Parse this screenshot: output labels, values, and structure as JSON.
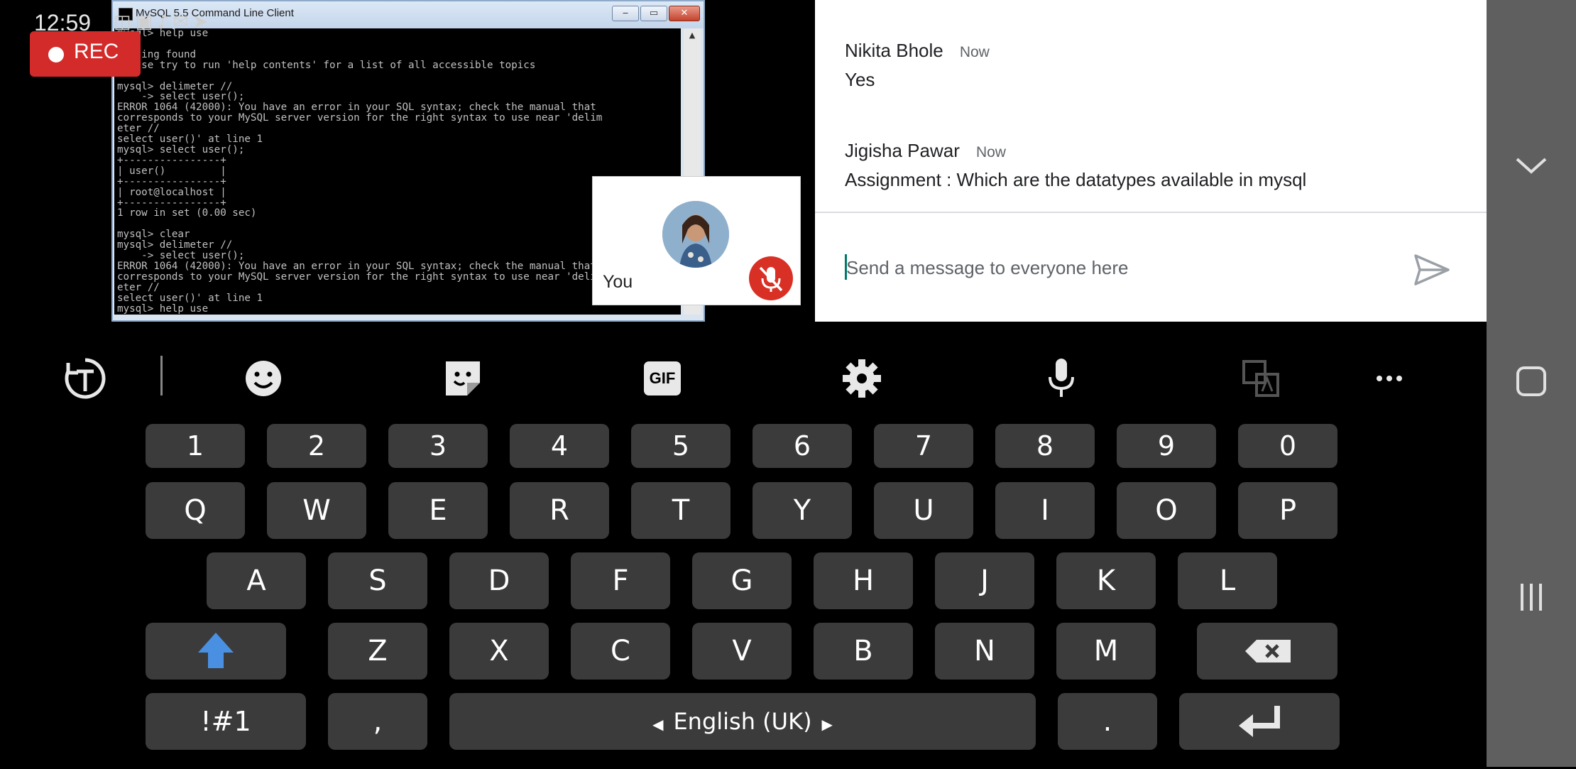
{
  "status_bar": {
    "time": "12:59",
    "icons": [
      "notification-icon",
      "image-icon",
      "audio-icon",
      "message-icon",
      "telegram-icon"
    ]
  },
  "recording": {
    "label": "REC"
  },
  "shared_screen": {
    "window_title": "MySQL 5.5 Command Line Client",
    "window_buttons": {
      "minimize": "‒",
      "maximize": "▭",
      "close": "✕"
    },
    "console_lines": [
      "mysql> help use",
      "",
      "Nothing found",
      "Please try to run 'help contents' for a list of all accessible topics",
      "",
      "mysql> delimeter //",
      "    -> select user();",
      "ERROR 1064 (42000): You have an error in your SQL syntax; check the manual that",
      "corresponds to your MySQL server version for the right syntax to use near 'delim",
      "eter //",
      "select user()' at line 1",
      "mysql> select user();",
      "+----------------+",
      "| user()         |",
      "+----------------+",
      "| root@localhost |",
      "+----------------+",
      "1 row in set (0.00 sec)",
      "",
      "mysql> clear",
      "mysql> delimeter //",
      "    -> select user();",
      "ERROR 1064 (42000): You have an error in your SQL syntax; check the manual that",
      "corresponds to your MySQL server version for the right syntax to use near 'delim",
      "eter //",
      "select user()' at line 1",
      "mysql> help use"
    ]
  },
  "self_tile": {
    "name": "You",
    "mic_state": "muted"
  },
  "chat": {
    "messages": [
      {
        "sender": "Nikita Bhole",
        "time": "Now",
        "text": "Yes"
      },
      {
        "sender": "Jigisha Pawar",
        "time": "Now",
        "text": "Assignment : Which are the datatypes available in mysql"
      }
    ],
    "input_placeholder": "Send a message to everyone here",
    "input_value": ""
  },
  "keyboard": {
    "toolbar": [
      "translate-icon",
      "emoji-icon",
      "sticker-icon",
      "GIF",
      "settings-icon",
      "mic-icon",
      "clipboard-icon",
      "more-icon"
    ],
    "gif_label": "GIF",
    "number_row": [
      "1",
      "2",
      "3",
      "4",
      "5",
      "6",
      "7",
      "8",
      "9",
      "0"
    ],
    "row1": [
      "Q",
      "W",
      "E",
      "R",
      "T",
      "Y",
      "U",
      "I",
      "O",
      "P"
    ],
    "row2": [
      "A",
      "S",
      "D",
      "F",
      "G",
      "H",
      "J",
      "K",
      "L"
    ],
    "row3": [
      "Z",
      "X",
      "C",
      "V",
      "B",
      "N",
      "M"
    ],
    "symbols_label": "!#1",
    "comma_label": ",",
    "space_label": "English (UK)",
    "period_label": ".",
    "accent_color": "#4a90e2"
  },
  "nav_bar": {
    "buttons": [
      "collapse-icon",
      "home-icon",
      "recents-icon"
    ]
  }
}
